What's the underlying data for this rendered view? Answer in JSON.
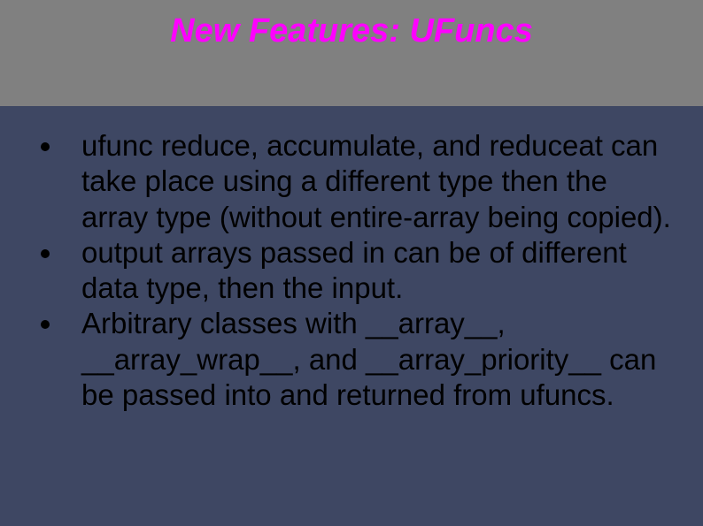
{
  "slide": {
    "title": "New Features: UFuncs",
    "bullets": [
      "ufunc reduce, accumulate, and reduceat can take place using a different type then the array type (without entire-array being copied).",
      "output arrays passed in can be of different data type, then the input.",
      "Arbitrary classes with __array__, __array_wrap__, and __array_priority__ can be passed into and returned from ufuncs."
    ]
  }
}
